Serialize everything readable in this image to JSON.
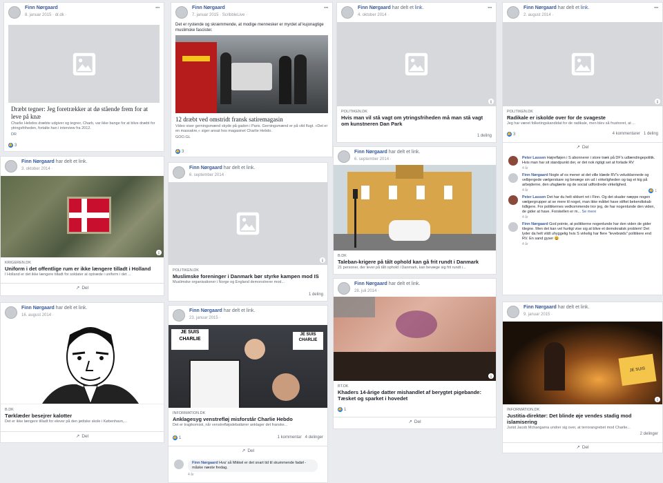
{
  "author": "Finn Nørgaard",
  "shared_link": "har delt et link.",
  "share_label": "Del",
  "posts": {
    "p1": {
      "date": "8. januar 2015 · dr.dk ·",
      "title": "Dræbt tegner: Jeg foretrækker at dø stående frem for at leve på knæ",
      "desc": "Charlie Hebdos dræbte udgiver og tegner, Charb, var ikke bange for at blive dræbt for ytringsfriheden, fortalte han i interview fra 2012.",
      "domain": "DR",
      "reactions": "3"
    },
    "p2": {
      "date": "7. januar 2015 · ScribbleLive ·",
      "text": "Det er rystende og skræmmende, at modige mennesker er myrdet af kujonagtige muslimske fascister.",
      "title": "12 dræbt ved omstridt fransk satiremagasin",
      "desc": "Video viser gerningsmænd skyde på gaden i Paris. Gerningsmænd er på vild flugt. »Det er en massakre,« siger ansat hos magasinet Charlie Hebdo.",
      "domain": "GOO.GL",
      "reactions": "3"
    },
    "p3": {
      "date": "4. oktober 2014 ·",
      "domain": "POLITIKEN.DK",
      "title": "Hvis man vil stå vagt om ytringsfriheden må man stå vagt om kunstneren Dan Park",
      "shares": "1 deling"
    },
    "p4": {
      "date": "2. august 2014 ·",
      "domain": "POLITIKEN.DK",
      "title": "Radikale er iskolde over for de svageste",
      "desc": "Jeg har været folketingskandidat for de radikale, men blev så frustreret, at ...",
      "reactions": "3",
      "comments": "4 kommentarer",
      "shares": "1 deling"
    },
    "p5": {
      "date": "3. oktober 2014 ·",
      "domain": "KRIGEREN.DK",
      "title": "Uniform i det offentlige rum er ikke længere tilladt i Holland",
      "desc": "I Holland er det ikke længere tilladt for soldater at optræde i uniform i det ..."
    },
    "p6": {
      "date": "6. september 2014 ·",
      "domain": "POLITIKEN.DK",
      "title": "Muslimske foreninger i Danmark bør styrke kampen mod IS",
      "desc": "Muslimske organisationer i Norge og England demonstrerer mod...",
      "shares": "1 deling"
    },
    "p7": {
      "date": "6. september 2014 ·",
      "domain": "B.DK",
      "title": "Taleban-krigere på tålt ophold kan gå frit rundt i Danmark",
      "desc": "21 personer, der lever på tålt ophold i Danmark, kan bevæge sig frit rundt i..."
    },
    "p8": {
      "date": "16. august 2014 ·",
      "domain": "B.DK",
      "title": "Tørklæder besejrer kalotter",
      "desc": "Det er ikke længere tilladt for elever på den jødiske skole i København,..."
    },
    "p9": {
      "date": "23. januar 2015 ·",
      "domain": "INFORMATION.DK",
      "title": "Anklagesyg venstrefløj misforstår Charlie Hebdo",
      "desc": "Det er tragikomisk, når venstrefløjsdebattører anklager det franske...",
      "reactions": "1",
      "comments": "1 kommentar",
      "shares": "4 delinger",
      "comment_text": "Hva' så Mikkel er det snart tid til skummende fadøl - måske næste fredag.",
      "comment_ago": "4 år"
    },
    "p10": {
      "date": "28. juli 2014 ·",
      "domain": "BT.DK",
      "title": "Khaders 14-årige datter mishandlet af berygtet pigebande: Tæsket og sparket i hovedet",
      "reactions": "1"
    },
    "p11": {
      "date": "9. januar 2015 ·",
      "domain": "INFORMATION.DK",
      "title": "Justitia-direktør: Det blinde øje vendes stadig mod islamisering",
      "desc": "Jurist Jacob Mchangama undrer sig over, at terrorangrebet mod Charlie...",
      "shares": "2 delinger"
    }
  },
  "comments_p4": [
    {
      "name": "Peter Lassen",
      "text": "Højrefløjen i S abonnerer i store træk på DF's udlændingepolitik. Hvis man har sit standpunkt der, er det nok rigtigt set at forlade RV",
      "ago": "4 år"
    },
    {
      "name": "Finn Nørgaard",
      "text": "Nogle af os mener at det ville klæde RV's veluddannede og velbjergede vælgerskare og bevæge sin ud i virkeligheden og tag et kig på arbejderne, den ufaglærte og de social udfordrede virkelighed.",
      "ago": "4 år",
      "reactions": "1"
    },
    {
      "name": "Peter Lassen",
      "text": "Det har du helt sikkert ret i Finn. Og det skader næppe nogen vælgergrupper at se mere til noget, man ikke måttet have stiftet bekendtskab tidligere. For politikernes vedkommende tror jeg, de har nogenlunde den viden, de gider at have. Forskellen er m...",
      "more": "Se mere",
      "ago": "4 år"
    },
    {
      "name": "Finn Nørgaard",
      "text": "God pointe, at politikerne nogenlunde har den viden de gider tilegne. Men det kan vel hurtigt vise sig at blive et demokratisk problem! Det lyder da helt vildt uhyggelig hvis S virkelig har flere \"levebrøds\" politikere end RV. En sand gyser 😃",
      "ago": "4 år"
    }
  ],
  "colors": {
    "link": "#365899",
    "bg": "#e9ebee",
    "placeholder": "#d7d8db",
    "like": "#1877f2"
  }
}
